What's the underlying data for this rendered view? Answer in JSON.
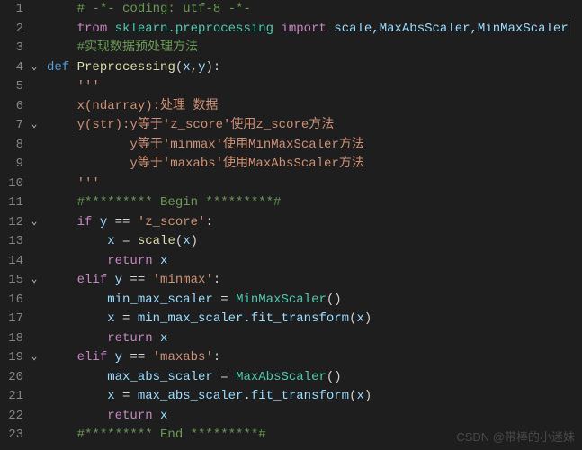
{
  "watermark": "CSDN @带棒的小迷妹",
  "lines": [
    {
      "n": "1",
      "fold": "",
      "segs": [
        {
          "t": "    ",
          "c": ""
        },
        {
          "t": "# -*- coding: utf-8 -*-",
          "c": "t-comment"
        }
      ]
    },
    {
      "n": "2",
      "fold": "",
      "segs": [
        {
          "t": "    ",
          "c": ""
        },
        {
          "t": "from",
          "c": "t-keyword"
        },
        {
          "t": " ",
          "c": ""
        },
        {
          "t": "sklearn.preprocessing",
          "c": "t-module"
        },
        {
          "t": " ",
          "c": ""
        },
        {
          "t": "import",
          "c": "t-keyword"
        },
        {
          "t": " ",
          "c": ""
        },
        {
          "t": "scale,MaxAbsScaler,MinMaxScaler",
          "c": "t-var"
        }
      ],
      "cursor": true
    },
    {
      "n": "3",
      "fold": "",
      "segs": [
        {
          "t": "    ",
          "c": ""
        },
        {
          "t": "#实现数据预处理方法",
          "c": "t-comment"
        }
      ]
    },
    {
      "n": "4",
      "fold": "⌄",
      "segs": [
        {
          "t": "def",
          "c": "t-def"
        },
        {
          "t": " ",
          "c": ""
        },
        {
          "t": "Preprocessing",
          "c": "t-func"
        },
        {
          "t": "(",
          "c": "t-punc"
        },
        {
          "t": "x",
          "c": "t-var"
        },
        {
          "t": ",",
          "c": "t-punc"
        },
        {
          "t": "y",
          "c": "t-var"
        },
        {
          "t": "):",
          "c": "t-punc"
        }
      ]
    },
    {
      "n": "5",
      "fold": "",
      "segs": [
        {
          "t": "    ",
          "c": ""
        },
        {
          "t": "'''",
          "c": "t-string"
        }
      ]
    },
    {
      "n": "6",
      "fold": "",
      "segs": [
        {
          "t": "    ",
          "c": ""
        },
        {
          "t": "x(ndarray):处理 数据",
          "c": "t-string"
        }
      ]
    },
    {
      "n": "7",
      "fold": "⌄",
      "segs": [
        {
          "t": "    ",
          "c": ""
        },
        {
          "t": "y(str):y等于'z_score'使用z_score方法",
          "c": "t-string"
        }
      ]
    },
    {
      "n": "8",
      "fold": "",
      "segs": [
        {
          "t": "           ",
          "c": ""
        },
        {
          "t": "y等于'minmax'使用MinMaxScaler方法",
          "c": "t-string"
        }
      ]
    },
    {
      "n": "9",
      "fold": "",
      "segs": [
        {
          "t": "           ",
          "c": ""
        },
        {
          "t": "y等于'maxabs'使用MaxAbsScaler方法",
          "c": "t-string"
        }
      ]
    },
    {
      "n": "10",
      "fold": "",
      "segs": [
        {
          "t": "    ",
          "c": ""
        },
        {
          "t": "'''",
          "c": "t-string"
        }
      ]
    },
    {
      "n": "11",
      "fold": "",
      "segs": [
        {
          "t": "    ",
          "c": ""
        },
        {
          "t": "#********* Begin *********#",
          "c": "t-comment"
        }
      ]
    },
    {
      "n": "12",
      "fold": "⌄",
      "segs": [
        {
          "t": "    ",
          "c": ""
        },
        {
          "t": "if",
          "c": "t-keyword"
        },
        {
          "t": " ",
          "c": ""
        },
        {
          "t": "y",
          "c": "t-var"
        },
        {
          "t": " == ",
          "c": "t-punc"
        },
        {
          "t": "'z_score'",
          "c": "t-string"
        },
        {
          "t": ":",
          "c": "t-punc"
        }
      ]
    },
    {
      "n": "13",
      "fold": "",
      "segs": [
        {
          "t": "        ",
          "c": ""
        },
        {
          "t": "x",
          "c": "t-var"
        },
        {
          "t": " = ",
          "c": "t-punc"
        },
        {
          "t": "scale",
          "c": "t-func"
        },
        {
          "t": "(",
          "c": "t-punc"
        },
        {
          "t": "x",
          "c": "t-var"
        },
        {
          "t": ")",
          "c": "t-punc"
        }
      ]
    },
    {
      "n": "14",
      "fold": "",
      "segs": [
        {
          "t": "        ",
          "c": ""
        },
        {
          "t": "return",
          "c": "t-keyword"
        },
        {
          "t": " ",
          "c": ""
        },
        {
          "t": "x",
          "c": "t-var"
        }
      ]
    },
    {
      "n": "15",
      "fold": "⌄",
      "segs": [
        {
          "t": "    ",
          "c": ""
        },
        {
          "t": "elif",
          "c": "t-keyword"
        },
        {
          "t": " ",
          "c": ""
        },
        {
          "t": "y",
          "c": "t-var"
        },
        {
          "t": " == ",
          "c": "t-punc"
        },
        {
          "t": "'minmax'",
          "c": "t-string"
        },
        {
          "t": ":",
          "c": "t-punc"
        }
      ]
    },
    {
      "n": "16",
      "fold": "",
      "segs": [
        {
          "t": "        ",
          "c": ""
        },
        {
          "t": "min_max_scaler",
          "c": "t-var"
        },
        {
          "t": " = ",
          "c": "t-punc"
        },
        {
          "t": "MinMaxScaler",
          "c": "t-module"
        },
        {
          "t": "()",
          "c": "t-punc"
        }
      ]
    },
    {
      "n": "17",
      "fold": "",
      "segs": [
        {
          "t": "        ",
          "c": ""
        },
        {
          "t": "x",
          "c": "t-var"
        },
        {
          "t": " = ",
          "c": "t-punc"
        },
        {
          "t": "min_max_scaler.fit_transform",
          "c": "t-var"
        },
        {
          "t": "(",
          "c": "t-punc"
        },
        {
          "t": "x",
          "c": "t-var"
        },
        {
          "t": ")",
          "c": "t-punc"
        }
      ]
    },
    {
      "n": "18",
      "fold": "",
      "segs": [
        {
          "t": "        ",
          "c": ""
        },
        {
          "t": "return",
          "c": "t-keyword"
        },
        {
          "t": " ",
          "c": ""
        },
        {
          "t": "x",
          "c": "t-var"
        }
      ]
    },
    {
      "n": "19",
      "fold": "⌄",
      "segs": [
        {
          "t": "    ",
          "c": ""
        },
        {
          "t": "elif",
          "c": "t-keyword"
        },
        {
          "t": " ",
          "c": ""
        },
        {
          "t": "y",
          "c": "t-var"
        },
        {
          "t": " == ",
          "c": "t-punc"
        },
        {
          "t": "'maxabs'",
          "c": "t-string"
        },
        {
          "t": ":",
          "c": "t-punc"
        }
      ]
    },
    {
      "n": "20",
      "fold": "",
      "segs": [
        {
          "t": "        ",
          "c": ""
        },
        {
          "t": "max_abs_scaler",
          "c": "t-var"
        },
        {
          "t": " = ",
          "c": "t-punc"
        },
        {
          "t": "MaxAbsScaler",
          "c": "t-module"
        },
        {
          "t": "()",
          "c": "t-punc"
        }
      ]
    },
    {
      "n": "21",
      "fold": "",
      "segs": [
        {
          "t": "        ",
          "c": ""
        },
        {
          "t": "x",
          "c": "t-var"
        },
        {
          "t": " = ",
          "c": "t-punc"
        },
        {
          "t": "max_abs_scaler.fit_transform",
          "c": "t-var"
        },
        {
          "t": "(",
          "c": "t-punc"
        },
        {
          "t": "x",
          "c": "t-var"
        },
        {
          "t": ")",
          "c": "t-punc"
        }
      ]
    },
    {
      "n": "22",
      "fold": "",
      "segs": [
        {
          "t": "        ",
          "c": ""
        },
        {
          "t": "return",
          "c": "t-keyword"
        },
        {
          "t": " ",
          "c": ""
        },
        {
          "t": "x",
          "c": "t-var"
        }
      ]
    },
    {
      "n": "23",
      "fold": "",
      "segs": [
        {
          "t": "    ",
          "c": ""
        },
        {
          "t": "#********* End *********#",
          "c": "t-comment"
        }
      ]
    }
  ]
}
